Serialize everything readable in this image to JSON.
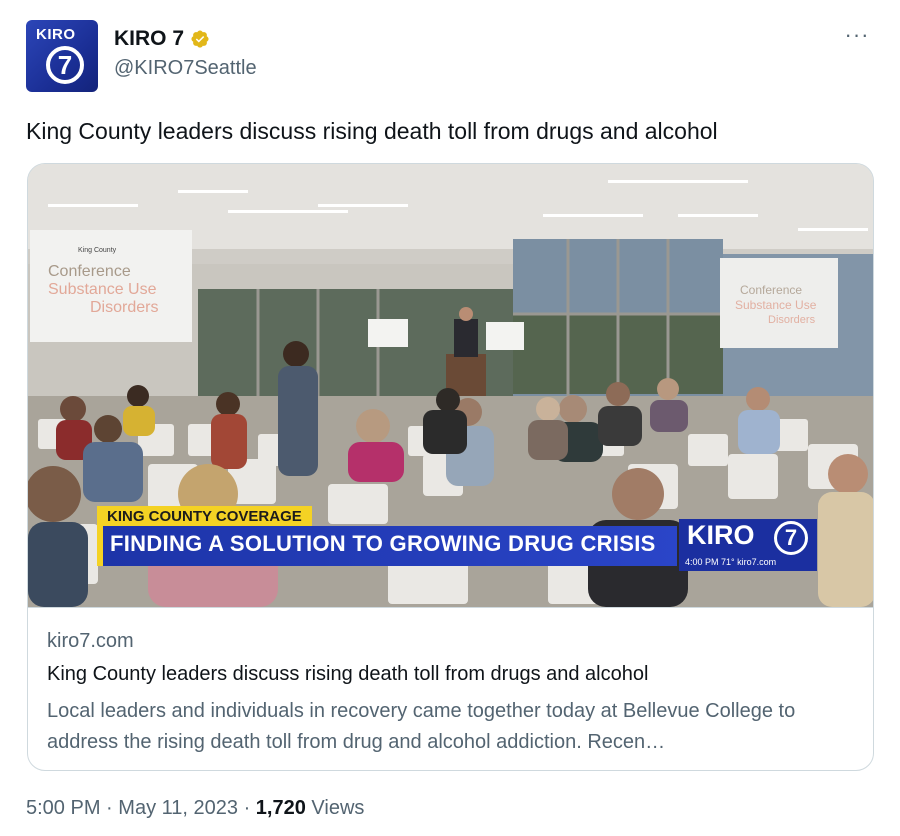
{
  "author": {
    "display_name": "KIRO 7",
    "handle": "@KIRO7Seattle",
    "avatar_text": "KIRO",
    "avatar_number": "7"
  },
  "tweet": {
    "text": "King County leaders discuss rising death toll from drugs and alcohol"
  },
  "card": {
    "domain": "kiro7.com",
    "title": "King County leaders discuss rising death toll from drugs and alcohol",
    "description": "Local leaders and individuals in recovery came together today at Bellevue College to address the rising death toll from drug and alcohol addiction. Recen…",
    "overlay": {
      "tag": "KING COUNTY COVERAGE",
      "headline": "FINDING A SOLUTION TO GROWING DRUG CRISIS",
      "logo_text": "KIRO",
      "logo_number": "7",
      "logo_sub": "4:00 PM 71° kiro7.com",
      "screen_left_brand": "King County",
      "screen_left_line1": "Conference",
      "screen_left_line2": "Substance Use",
      "screen_left_line3": "Disorders",
      "screen_right_line1": "Conference",
      "screen_right_line2": "Substance Use",
      "screen_right_line3": "Disorders"
    }
  },
  "footer": {
    "time": "5:00 PM",
    "separator": "·",
    "date": "May 11, 2023",
    "views_count": "1,720",
    "views_label": "Views"
  },
  "icons": {
    "verified": "verified-badge-icon",
    "more": "more-options-icon"
  },
  "colors": {
    "text_primary": "#0f1419",
    "text_secondary": "#536471",
    "border": "#cfd9de",
    "verified_gold": "#e2b719",
    "kiro_blue": "#1d34a8",
    "lower_third_yellow": "#f4d224"
  }
}
